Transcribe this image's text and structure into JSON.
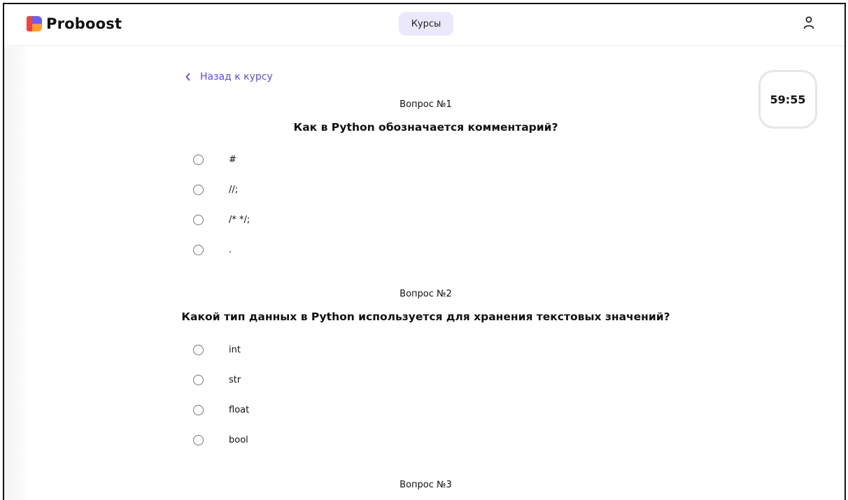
{
  "header": {
    "brand": "Proboost",
    "nav_courses": "Курсы"
  },
  "back_link": {
    "label": "Назад к курсу"
  },
  "timer": {
    "value": "59:55"
  },
  "questions": [
    {
      "number": "Вопрос №1",
      "text": "Как в Python обозначается комментарий?",
      "options": [
        "#",
        "//;",
        "/* */;",
        "."
      ]
    },
    {
      "number": "Вопрос №2",
      "text": "Какой тип данных в Python используется для хранения текстовых значений?",
      "options": [
        "int",
        "str",
        "float",
        "bool"
      ]
    },
    {
      "number": "Вопрос №3"
    }
  ],
  "colors": {
    "accent": "#5b4de0",
    "nav_pill_bg": "#ece8fb",
    "logo_red": "#f0453a",
    "logo_purple": "#6d5cff",
    "logo_orange": "#ff9d2a"
  }
}
